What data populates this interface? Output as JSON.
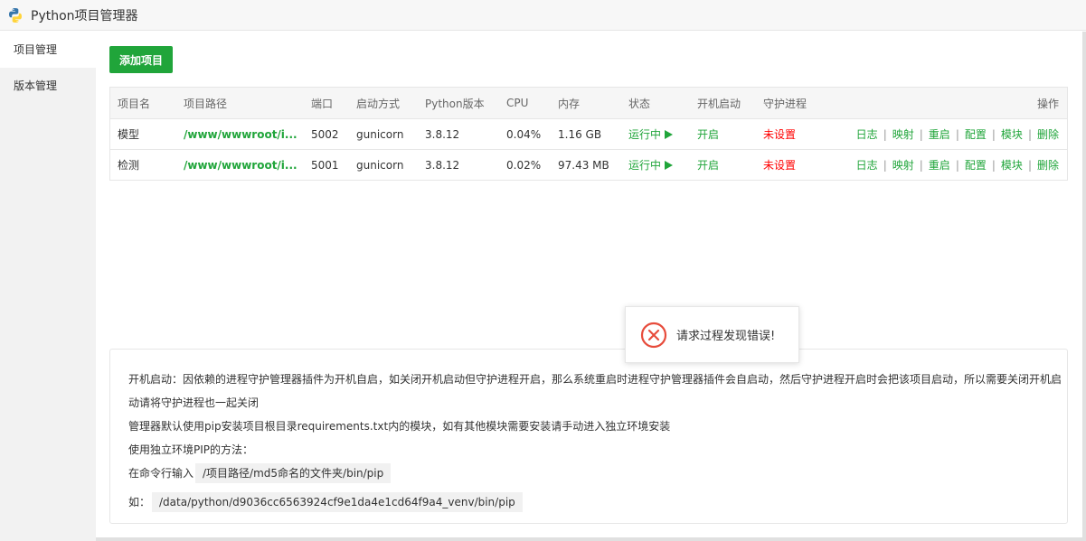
{
  "window": {
    "title": "Python项目管理器",
    "logo_icon": "python-logo-icon"
  },
  "sidebar": {
    "items": [
      {
        "label": "项目管理",
        "active": true
      },
      {
        "label": "版本管理",
        "active": false
      }
    ]
  },
  "toolbar": {
    "add_label": "添加项目"
  },
  "table": {
    "headers": [
      "项目名",
      "项目路径",
      "端口",
      "启动方式",
      "Python版本",
      "CPU",
      "内存",
      "状态",
      "开机启动",
      "守护进程",
      "操作"
    ],
    "rows": [
      {
        "name": "模型",
        "path": "/www/wwwroot/i...",
        "port": "5002",
        "method": "gunicorn",
        "python": "3.8.12",
        "cpu": "0.04%",
        "mem": "1.16 GB",
        "status": "运行中",
        "boot": "开启",
        "daemon": "未设置"
      },
      {
        "name": "检测",
        "path": "/www/wwwroot/i...",
        "port": "5001",
        "method": "gunicorn",
        "python": "3.8.12",
        "cpu": "0.02%",
        "mem": "97.43 MB",
        "status": "运行中",
        "boot": "开启",
        "daemon": "未设置"
      }
    ],
    "ops": [
      "日志",
      "映射",
      "重启",
      "配置",
      "模块",
      "删除"
    ]
  },
  "toast": {
    "message": "请求过程发现错误!",
    "icon": "error-circle-icon"
  },
  "info": {
    "line1": "开机启动：因依赖的进程守护管理器插件为开机自启，如关闭开机启动但守护进程开启，那么系统重启时进程守护管理器插件会自启动，然后守护进程开启时会把该项目启动，所以需要关闭开机启",
    "line2": "动请将守护进程也一起关闭",
    "line3": "管理器默认使用pip安装项目根目录requirements.txt内的模块，如有其他模块需要安装请手动进入独立环境安装",
    "line4": "使用独立环境PIP的方法：",
    "cmd_label": "在命令行输入",
    "cmd_code": "/项目路径/md5命名的文件夹/bin/pip",
    "eg_label": "如：",
    "eg_code": "/data/python/d9036cc6563924cf9e1da4e1cd64f9a4_venv/bin/pip"
  },
  "colors": {
    "accent": "#20a53a",
    "error": "#ff0000",
    "sidebar_bg": "#f2f2f2"
  }
}
